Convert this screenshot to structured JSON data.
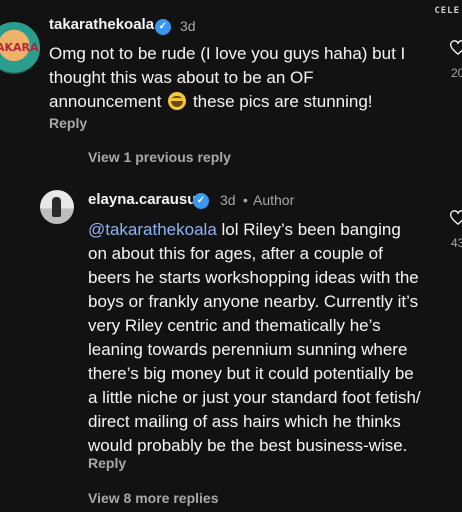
{
  "corner_tag": "CELE",
  "comment": {
    "username": "takarathekoala",
    "age": "3d",
    "avatar_text": "AKARA",
    "text": "Omg not to be rude (I love you guys haha) but I thought this was about to be an OF announcement",
    "text_after_emoji": "these pics are stunning!",
    "emoji": "laughing-face-emoji",
    "reply_label": "Reply",
    "like_count": "20"
  },
  "thread": {
    "view_previous_label": "View 1 previous reply",
    "view_more_label": "View 8 more replies"
  },
  "reply": {
    "username": "elayna.carausu",
    "age": "3d",
    "separator": "•",
    "author_label": "Author",
    "mention": "@takarathekoala",
    "text": "lol Riley’s been banging on about this for ages, after a couple of beers he starts workshopping ideas with the boys or frankly anyone nearby. Currently it’s very Riley centric and thematically he’s leaning towards perennium sunning where there’s big money but it could potentially be a little niche or just your standard foot fetish/ direct mailing of ass hairs which he thinks would probably be the best business-wise.",
    "reply_label": "Reply",
    "like_count": "43"
  },
  "colors": {
    "background": "#121212",
    "text": "#f5f5f5",
    "muted": "#a8a8a8",
    "mention": "#8fb4f5",
    "verified": "#3897f0"
  }
}
